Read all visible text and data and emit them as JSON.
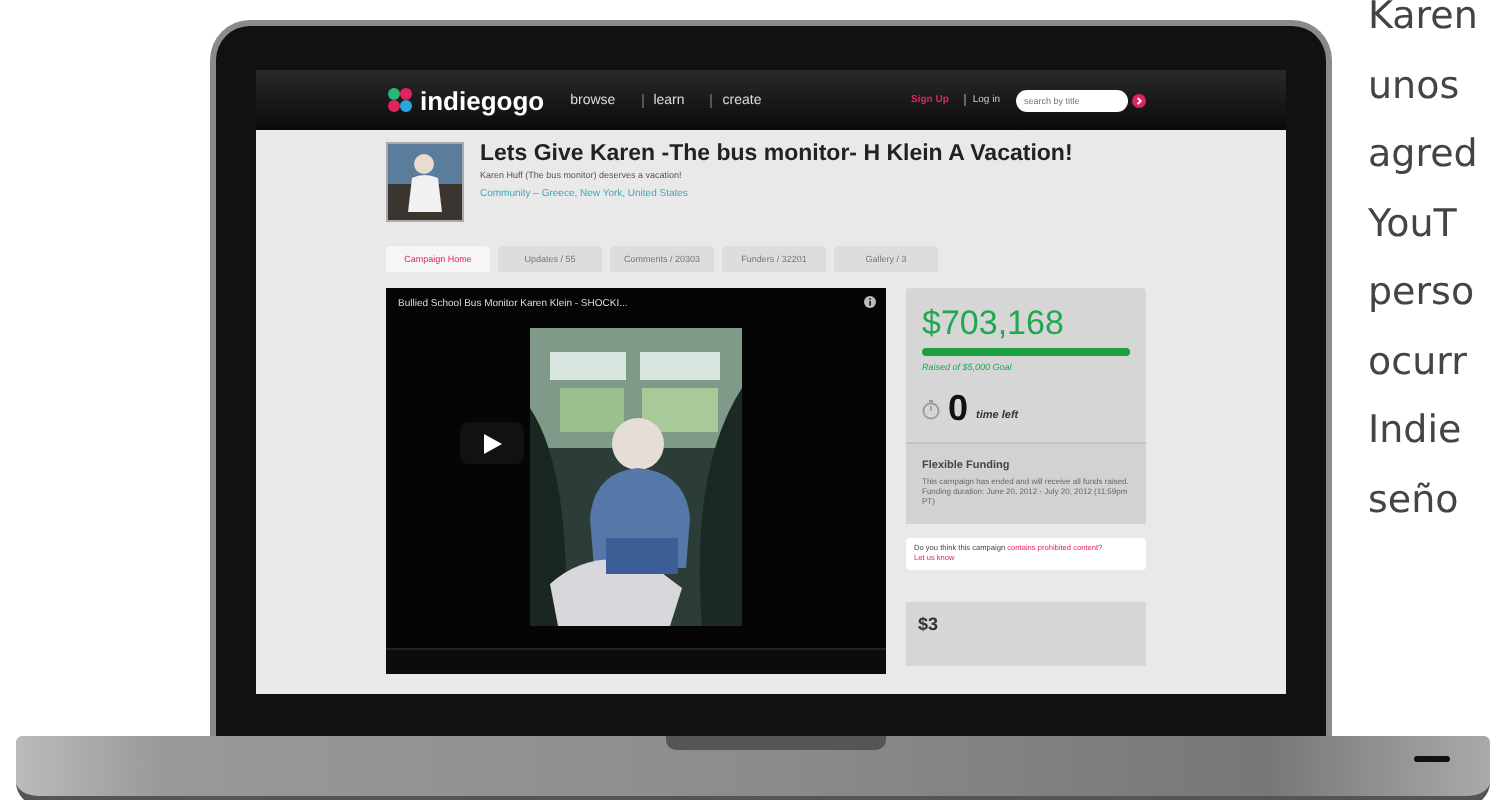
{
  "nav": {
    "logo": "indiegogo",
    "links": [
      "browse",
      "learn",
      "create"
    ],
    "sign_up": "Sign Up",
    "log_in": "Log in",
    "search": {
      "placeholder": "search by title"
    }
  },
  "campaign": {
    "title": "Lets Give Karen -The bus monitor- H Klein A Vacation!",
    "subtitle": "Karen Huff (The bus monitor) deserves a vacation!",
    "location": "Community – Greece, New York, United States"
  },
  "tabs": [
    {
      "label": "Campaign Home",
      "selected": true
    },
    {
      "label": "Updates / 55",
      "selected": false
    },
    {
      "label": "Comments / 20303",
      "selected": false
    },
    {
      "label": "Funders / 32201",
      "selected": false
    },
    {
      "label": "Gallery / 3",
      "selected": false
    }
  ],
  "video": {
    "title": "Bullied School Bus Monitor Karen Klein - SHOCKI..."
  },
  "funding": {
    "amount": "$703,168",
    "level": 1,
    "goal": "Raised of $5,000 Goal",
    "time_value": "0",
    "time_label": "time left",
    "type_title": "Flexible Funding",
    "description": "This campaign has ended and will receive all funds raised. Funding duration: June 20, 2012 - July 20, 2012 (11:59pm PT)"
  },
  "report": {
    "text": "Do you think this campaign ",
    "link": "contains prohibited content?",
    "action": "Let us know"
  },
  "perk": {
    "amount": "$3"
  },
  "article_lines": [
    "Karen",
    "unos",
    "agred",
    "YouT",
    "perso",
    "ocurr",
    "Indie",
    "seño"
  ]
}
